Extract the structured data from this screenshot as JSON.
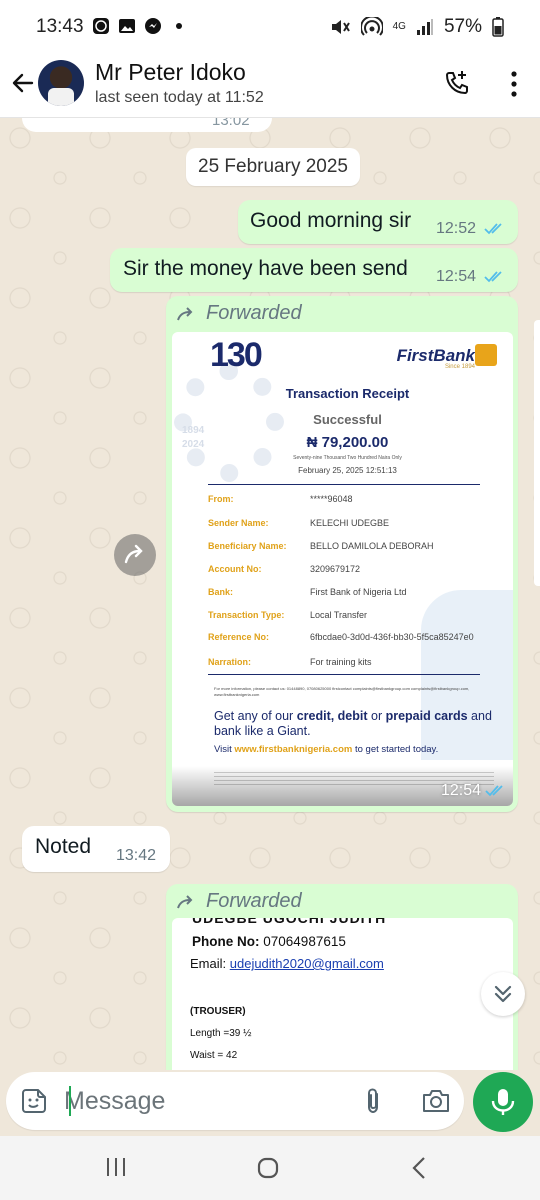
{
  "status_bar": {
    "time": "13:43",
    "battery": "57%",
    "network": "4G",
    "icons": [
      "whatsapp-icon",
      "gallery-icon",
      "messenger-icon",
      "dot-icon",
      "mute-icon",
      "hotspot-icon",
      "signal-icon",
      "battery-icon"
    ]
  },
  "header": {
    "contact_name": "Mr Peter Idoko",
    "last_seen": "last seen today at 11:52",
    "icons": [
      "back-arrow-icon",
      "add-call-icon",
      "more-vert-icon"
    ]
  },
  "chat": {
    "previous_time": "13:02",
    "date_divider": "25 February 2025",
    "messages": [
      {
        "direction": "out",
        "text": "Good morning sir",
        "time": "12:52",
        "status": "read"
      },
      {
        "direction": "out",
        "text": "Sir the money have been send",
        "time": "12:54",
        "status": "read"
      },
      {
        "direction": "out",
        "forwarded_label": "Forwarded",
        "type": "image",
        "time": "12:54",
        "status": "read"
      },
      {
        "direction": "in",
        "text": "Noted",
        "time": "13:42"
      },
      {
        "direction": "out",
        "forwarded_label": "Forwarded",
        "type": "image"
      }
    ],
    "receipt": {
      "anniversary": "130",
      "years": "1894\n2024",
      "bank": "FirstBank",
      "bank_since": "Since 1894",
      "title": "Transaction Receipt",
      "status": "Successful",
      "amount": "₦ 79,200.00",
      "amount_words": "Seventy-nine Thousand Two Hundred Naira Only",
      "date": "February 25, 2025 12:51:13",
      "rows": [
        {
          "label": "From:",
          "value": "*****96048"
        },
        {
          "label": "Sender Name:",
          "value": "KELECHI UDEGBE"
        },
        {
          "label": "Beneficiary Name:",
          "value": "BELLO DAMILOLA DEBORAH"
        },
        {
          "label": "Account No:",
          "value": "3209679172"
        },
        {
          "label": "Bank:",
          "value": "First Bank of Nigeria Ltd"
        },
        {
          "label": "Transaction Type:",
          "value": "Local Transfer"
        },
        {
          "label": "Reference No:",
          "value": "6fbcdae0-3d0d-436f-bb30-5f5ca85247e0"
        },
        {
          "label": "Narration:",
          "value": "For training kits"
        }
      ],
      "fine_print": "For more information, please contact us: 01448890, 07080625000 firstcontact complaints@firstbankgroup.com complaints@firstbankgroup.com, www.firstbanknigeria.com",
      "promo_1": "Get any of our ",
      "promo_bold_1": "credit, debit",
      "promo_2": " or ",
      "promo_bold_2": "prepaid cards",
      "promo_3": " and bank like a Giant.",
      "visit_prefix": "Visit ",
      "visit_link": "www.firstbanknigeria.com",
      "visit_suffix": " to get started today."
    },
    "document": {
      "heading": "UDEGBE UGOCHI JUDITH",
      "phone_label": "Phone No:",
      "phone_value": "07064987615",
      "email_label": "Email:",
      "email_value": "udejudith2020@gmail.com",
      "section": "(TROUSER)",
      "length": "Length =39 ½",
      "waist": "Waist = 42"
    }
  },
  "input": {
    "placeholder": "Message",
    "icons": [
      "sticker-icon",
      "attach-icon",
      "camera-icon",
      "mic-icon"
    ]
  },
  "colors": {
    "accent": "#1fa855",
    "outgoing_bubble": "#d9fdd3",
    "incoming_bubble": "#ffffff",
    "read_tick": "#53bdeb",
    "chat_bg": "#efe7da"
  }
}
